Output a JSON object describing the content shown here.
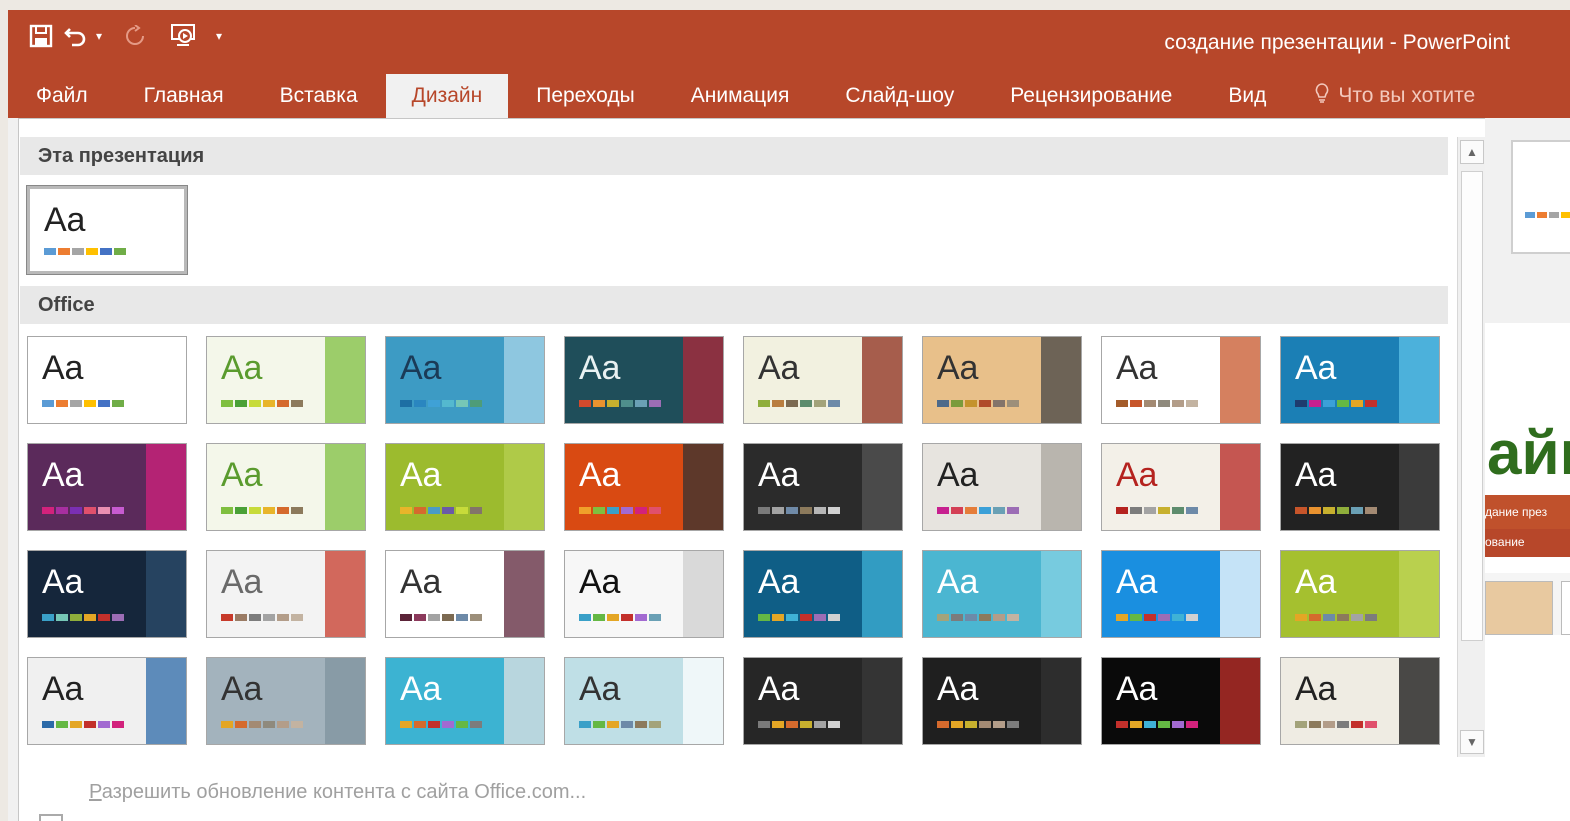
{
  "window": {
    "title": "создание презентации - PowerPoint"
  },
  "qat": {
    "save": "save-icon",
    "undo": "undo-icon",
    "redo": "redo-icon",
    "present": "slideshow-icon",
    "more": "customize-icon"
  },
  "tabs": [
    {
      "label": "Файл"
    },
    {
      "label": "Главная"
    },
    {
      "label": "Вставка"
    },
    {
      "label": "Дизайн",
      "active": true
    },
    {
      "label": "Переходы"
    },
    {
      "label": "Анимация"
    },
    {
      "label": "Слайд-шоу"
    },
    {
      "label": "Рецензирование"
    },
    {
      "label": "Вид"
    },
    {
      "label": "Что вы хотите"
    }
  ],
  "gallery": {
    "section_this": "Эта презентация",
    "section_office": "Office",
    "thumbnail_text": "Аа",
    "footer_link_u": "Р",
    "footer_link_rest": "азрешить обновление контента с сайта Office.com..."
  },
  "themes": [
    {
      "bg": "#ffffff",
      "fg": "#222222",
      "sw": [
        "#5b9bd5",
        "#ed7d31",
        "#a5a5a5",
        "#ffc000",
        "#4472c4",
        "#70ad47"
      ]
    },
    {
      "bg": "#ffffff",
      "fg": "#222222",
      "sw": [
        "#5b9bd5",
        "#ed7d31",
        "#a5a5a5",
        "#ffc000",
        "#4472c4",
        "#70ad47"
      ]
    },
    {
      "bg": "#f4f7ea",
      "fg": "#5a9b2e",
      "accent": "#7fbf3f",
      "sw": [
        "#7fbf3f",
        "#4aa137",
        "#c7db3a",
        "#e8b52a",
        "#d56a2d",
        "#8c7a5c"
      ]
    },
    {
      "bg": "#3d9bc4",
      "fg": "#1b3b57",
      "accent": "#a9d6ea",
      "sw": [
        "#1d6fa4",
        "#2a86c0",
        "#3fa1d6",
        "#54b9cf",
        "#76c7b6",
        "#4e9c79"
      ]
    },
    {
      "bg": "#1f4e5a",
      "fg": "#e8f1f2",
      "accent": "#b0283a",
      "sw": [
        "#d34a2d",
        "#e9922f",
        "#c7b02e",
        "#4f8f8c",
        "#6aa0b5",
        "#9c6db5"
      ]
    },
    {
      "bg": "#f2f1e0",
      "fg": "#333333",
      "accent": "#8c2b1b",
      "sw": [
        "#8fae3b",
        "#b97d3f",
        "#7c6a51",
        "#5d8c6d",
        "#a3a37a",
        "#6d8aa8"
      ]
    },
    {
      "bg": "#e8c08a",
      "fg": "#333333",
      "accent": "#444444",
      "sw": [
        "#4d6a8a",
        "#7a9b3c",
        "#c4932d",
        "#b04b2b",
        "#83746a",
        "#9c8f7a"
      ]
    },
    {
      "bg": "#ffffff",
      "fg": "#333333",
      "accent": "#c7552a",
      "sw": [
        "#a45c2a",
        "#c7552a",
        "#a38a73",
        "#8f8a7d",
        "#b39d89",
        "#c3b3a1"
      ]
    },
    {
      "bg": "#1b7fb5",
      "fg": "#ffffff",
      "accent": "#5ec1e8",
      "sw": [
        "#1e3b6e",
        "#c7208f",
        "#3ba0d8",
        "#65b844",
        "#e4a625",
        "#c3302b"
      ]
    },
    {
      "bg": "#5b2a5b",
      "fg": "#ffffff",
      "accent": "#d2227c",
      "sw": [
        "#d2227c",
        "#a72fa0",
        "#7a2fb3",
        "#e0506c",
        "#e98fb1",
        "#c75bd0"
      ]
    },
    {
      "bg": "#f4f7ea",
      "fg": "#5a9b2e",
      "accent": "#7fbf3f",
      "sw": [
        "#7fbf3f",
        "#4aa137",
        "#c7db3a",
        "#e8b52a",
        "#d56a2d",
        "#8c7a5c"
      ]
    },
    {
      "bg": "#9cbb2e",
      "fg": "#ffffff",
      "accent": "#b6cf52",
      "sw": [
        "#e8b52a",
        "#d56a2d",
        "#4a9bc7",
        "#6a5aa8",
        "#c7db3a",
        "#83746a"
      ]
    },
    {
      "bg": "#d94a12",
      "fg": "#ffffff",
      "accent": "#333333",
      "sw": [
        "#f0a02a",
        "#7fbf3f",
        "#3aa0c8",
        "#a26ad1",
        "#d2227c",
        "#e0506c"
      ]
    },
    {
      "bg": "#2b2b2b",
      "fg": "#ffffff",
      "accent": "#555555",
      "sw": [
        "#7a7a7a",
        "#a3a3a3",
        "#6f8aa8",
        "#8c7a5c",
        "#b6b6b6",
        "#d1d1d1"
      ]
    },
    {
      "bg": "#e7e4df",
      "fg": "#222222",
      "accent": "#a9a59e",
      "sw": [
        "#c7208f",
        "#d43f55",
        "#e57d3a",
        "#3ba0d8",
        "#6aa0b5",
        "#9c6db5"
      ]
    },
    {
      "bg": "#f3f0e8",
      "fg": "#b5231f",
      "accent": "#b5231f",
      "sw": [
        "#b5231f",
        "#7c7c7c",
        "#a3a3a3",
        "#c7b02e",
        "#5d8c6d",
        "#6d8aa8"
      ]
    },
    {
      "bg": "#222222",
      "fg": "#ffffff",
      "accent": "#444444",
      "sw": [
        "#c7552a",
        "#e9922f",
        "#c7b02e",
        "#8fae3b",
        "#6aa0b5",
        "#a38a73"
      ]
    },
    {
      "bg": "#15263b",
      "fg": "#ffffff",
      "accent": "#2c4d6e",
      "sw": [
        "#3aa0c8",
        "#76c7b6",
        "#8fae3b",
        "#e4a625",
        "#c3302b",
        "#9c6db5"
      ]
    },
    {
      "bg": "#f3f3f3",
      "fg": "#6a6a6a",
      "accent": "#c73a2a",
      "sw": [
        "#c73a2a",
        "#9a7b64",
        "#7c7c7c",
        "#a3a3a3",
        "#b39d89",
        "#c3b3a1"
      ]
    },
    {
      "bg": "#ffffff",
      "fg": "#333333",
      "accent": "#5b2338",
      "sw": [
        "#5b2338",
        "#8c3a5c",
        "#a3a3a3",
        "#7c6a51",
        "#6d8aa8",
        "#9c8f7a"
      ]
    },
    {
      "bg": "#f7f7f7",
      "fg": "#111111",
      "accent": "#cfcfcf",
      "sw": [
        "#3aa0c8",
        "#65b844",
        "#e4a625",
        "#c3302b",
        "#a26ad1",
        "#6aa0b5"
      ]
    },
    {
      "bg": "#0f5e86",
      "fg": "#ffffff",
      "accent": "#3fb2d6",
      "sw": [
        "#65b844",
        "#e4a625",
        "#3fb2d6",
        "#c3302b",
        "#9c6db5",
        "#d1d1d1"
      ]
    },
    {
      "bg": "#4bb6d1",
      "fg": "#ffffff",
      "accent": "#86d1e3",
      "sw": [
        "#a3a37a",
        "#7c7c7c",
        "#6d8aa8",
        "#8c7a5c",
        "#b39d89",
        "#c3b3a1"
      ]
    },
    {
      "bg": "#1a8fe0",
      "fg": "#ffffff",
      "accent": "#ffffff",
      "sw": [
        "#e4a625",
        "#65b844",
        "#c3302b",
        "#9c6db5",
        "#3fb2d6",
        "#d1d1d1"
      ]
    },
    {
      "bg": "#a5c02f",
      "fg": "#ffffff",
      "accent": "#c0d65a",
      "sw": [
        "#e4a625",
        "#d56a2d",
        "#6d8aa8",
        "#8c7a5c",
        "#a3a3a3",
        "#7c7c7c"
      ]
    },
    {
      "bg": "#f0f0f0",
      "fg": "#222222",
      "accent": "#2c6aa8",
      "sw": [
        "#2c6aa8",
        "#65b844",
        "#e4a625",
        "#c3302b",
        "#a26ad1",
        "#d2227c"
      ]
    },
    {
      "bg": "#a3b3bd",
      "fg": "#333333",
      "accent": "#7f939f",
      "sw": [
        "#e4a625",
        "#d56a2d",
        "#a38a73",
        "#8f8a7d",
        "#b39d89",
        "#c3b3a1"
      ]
    },
    {
      "bg": "#3cb3d2",
      "fg": "#ffffff",
      "accent": "#e1e1e1",
      "sw": [
        "#e4a625",
        "#d56a2d",
        "#c3302b",
        "#a26ad1",
        "#65b844",
        "#7c7c7c"
      ]
    },
    {
      "bg": "#bfdfe6",
      "fg": "#333333",
      "accent": "#ffffff",
      "sw": [
        "#3aa0c8",
        "#65b844",
        "#e4a625",
        "#6d8aa8",
        "#8c7a5c",
        "#a3a37a"
      ]
    },
    {
      "bg": "#262626",
      "fg": "#ffffff",
      "accent": "#3a3a3a",
      "sw": [
        "#7a7a7a",
        "#e4a625",
        "#d56a2d",
        "#c7b02e",
        "#a3a3a3",
        "#d1d1d1"
      ]
    },
    {
      "bg": "#1f1f1f",
      "fg": "#ffffff",
      "accent": "#333333",
      "sw": [
        "#d56a2d",
        "#e4a625",
        "#c7b02e",
        "#a38a73",
        "#b39d89",
        "#7c7c7c"
      ]
    },
    {
      "bg": "#0a0a0a",
      "fg": "#ffffff",
      "accent": "#c3302b",
      "sw": [
        "#c3302b",
        "#e4a625",
        "#3fb2d6",
        "#65b844",
        "#a26ad1",
        "#d2227c"
      ]
    },
    {
      "bg": "#efece3",
      "fg": "#222222",
      "accent": "#111111",
      "sw": [
        "#a3a37a",
        "#8c7a5c",
        "#b39d89",
        "#7c7c7c",
        "#c3302b",
        "#e0506c"
      ]
    }
  ],
  "right_peek": {
    "big": "айн",
    "bar_text": "дание през",
    "bar_text2": "ование"
  }
}
